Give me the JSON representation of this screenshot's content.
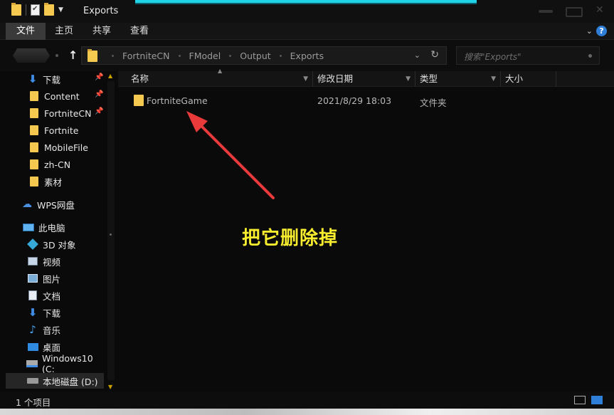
{
  "window": {
    "title": "Exports"
  },
  "ribbon": {
    "tabs": [
      {
        "label": "文件",
        "active": true
      },
      {
        "label": "主页",
        "active": false
      },
      {
        "label": "共享",
        "active": false
      },
      {
        "label": "查看",
        "active": false
      }
    ],
    "help_icon": "help-icon"
  },
  "address": {
    "crumbs": [
      "FortniteCN",
      "FModel",
      "Output",
      "Exports"
    ]
  },
  "search": {
    "placeholder": "搜索\"Exports\""
  },
  "nav": {
    "quick_access": [
      {
        "label": "下载",
        "icon": "download-icon",
        "pinned": true
      },
      {
        "label": "Content",
        "icon": "folder-icon",
        "pinned": true
      },
      {
        "label": "FortniteCN",
        "icon": "folder-icon",
        "pinned": true
      },
      {
        "label": "Fortnite",
        "icon": "folder-icon",
        "pinned": false
      },
      {
        "label": "MobileFile",
        "icon": "folder-icon",
        "pinned": false
      },
      {
        "label": "zh-CN",
        "icon": "folder-icon",
        "pinned": false
      },
      {
        "label": "素材",
        "icon": "folder-icon",
        "pinned": false
      }
    ],
    "wps": {
      "label": "WPS网盘",
      "icon": "cloud-icon"
    },
    "this_pc": {
      "label": "此电脑",
      "icon": "computer-icon"
    },
    "pc_items": [
      {
        "label": "3D 对象",
        "icon": "3d-objects-icon"
      },
      {
        "label": "视频",
        "icon": "video-icon"
      },
      {
        "label": "图片",
        "icon": "picture-icon"
      },
      {
        "label": "文档",
        "icon": "document-icon"
      },
      {
        "label": "下载",
        "icon": "download-icon"
      },
      {
        "label": "音乐",
        "icon": "music-icon"
      },
      {
        "label": "桌面",
        "icon": "desktop-icon"
      },
      {
        "label": "Windows10 (C:",
        "icon": "windows-drive-icon"
      },
      {
        "label": "本地磁盘 (D:)",
        "icon": "disk-icon"
      }
    ]
  },
  "columns": [
    {
      "label": "名称"
    },
    {
      "label": "修改日期"
    },
    {
      "label": "类型"
    },
    {
      "label": "大小"
    }
  ],
  "files": [
    {
      "name": "FortniteGame",
      "modified": "2021/8/29 18:03",
      "type": "文件夹",
      "icon": "folder-icon"
    }
  ],
  "annotation": {
    "text": "把它删除掉",
    "color": "#f7ec2d",
    "arrow_color": "#e83a3a"
  },
  "status": {
    "item_count": "1 个项目"
  },
  "colors": {
    "accent": "#2f7fd8",
    "title_strip": "#21d3e6",
    "folder": "#f5c850"
  }
}
